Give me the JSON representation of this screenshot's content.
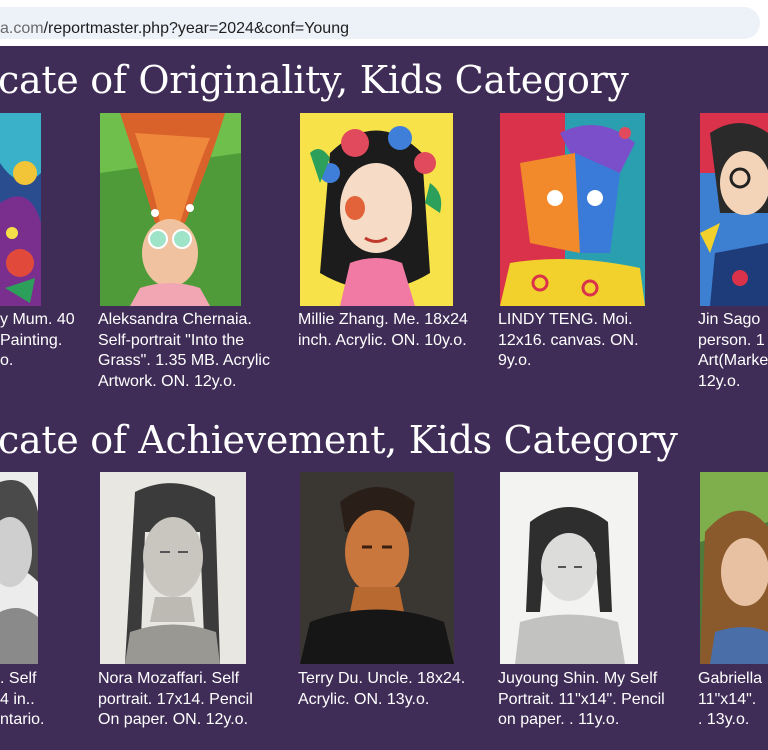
{
  "browser": {
    "url_domain": "a.com",
    "url_path": "/reportmaster.php?year=2024&conf=Young"
  },
  "sections": [
    {
      "heading": "cate of Originality, Kids Category",
      "items": [
        {
          "caption": "y Mum. 40\nPainting.\no."
        },
        {
          "caption": "Aleksandra Chernaia.\nSelf-portrait \"Into the\nGrass\". 1.35 MB. Acrylic\nArtwork. ON. 12y.o."
        },
        {
          "caption": "Millie Zhang. Me. 18x24\ninch. Acrylic. ON. 10y.o."
        },
        {
          "caption": "LINDY TENG. Moi.\n12x16. canvas. ON.\n9y.o."
        },
        {
          "caption": "Jin Sago\nperson. 1\nArt(Marke\n12y.o."
        }
      ]
    },
    {
      "heading": "cate of Achievement, Kids Category",
      "items": [
        {
          "caption": ". Self\n4 in..\nntario."
        },
        {
          "caption": "Nora Mozaffari. Self\nportrait. 17x14. Pencil\nOn paper. ON. 12y.o."
        },
        {
          "caption": "Terry Du. Uncle. 18x24.\nAcrylic. ON. 13y.o."
        },
        {
          "caption": "Juyoung Shin. My Self\nPortrait. 11\"x14\". Pencil\non paper. . 11y.o."
        },
        {
          "caption": "Gabriella\n11\"x14\".\n. 13y.o."
        }
      ]
    }
  ]
}
